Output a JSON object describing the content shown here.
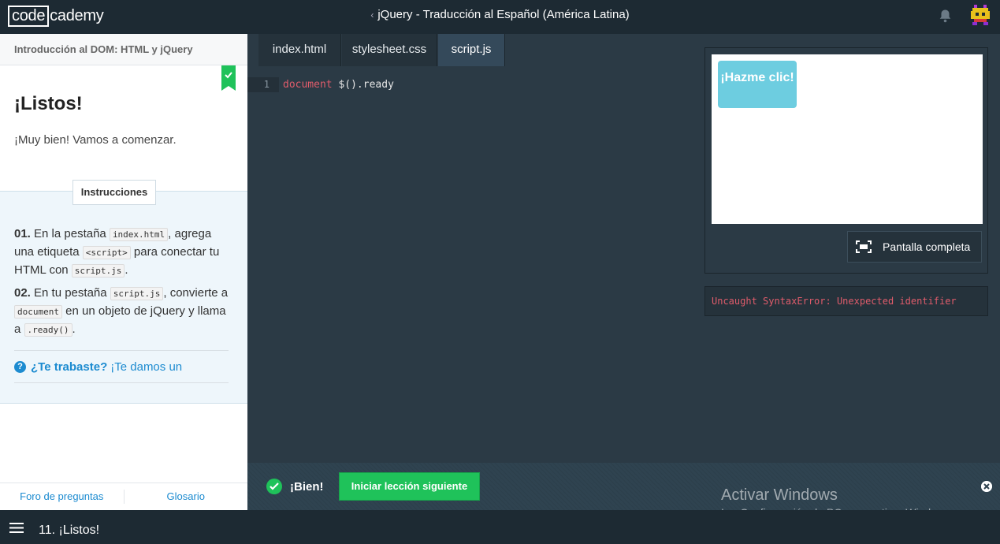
{
  "header": {
    "logo_box": "code",
    "logo_rest": "cademy",
    "course_title": "jQuery - Traducción al Español (América Latina)",
    "back_glyph": "‹"
  },
  "lesson": {
    "section": "Introducción al DOM: HTML y jQuery",
    "title": "¡Listos!",
    "description": "¡Muy bien! Vamos a comenzar.",
    "instructions_tab": "Instrucciones",
    "step1": {
      "num": "01.",
      "t1": " En la pestaña ",
      "c1": "index.html",
      "t2": ", agrega una etiqueta ",
      "c2": "<script>",
      "t3": " para conectar tu HTML con ",
      "c3": "script.js",
      "t4": "."
    },
    "step2": {
      "num": "02.",
      "t1": " En tu pestaña ",
      "c1": "script.js",
      "t2": ", convierte a ",
      "c2": "document",
      "t3": " en un objeto de jQuery y llama a ",
      "c3": ".ready()",
      "t4": "."
    },
    "hint_bold": "¿Te trabaste?",
    "hint_text": "¡Te damos un",
    "footer_links": [
      "Foro de preguntas",
      "Glosario"
    ]
  },
  "editor": {
    "tabs": [
      "index.html",
      "stylesheet.css",
      "script.js"
    ],
    "active_tab": "script.js",
    "line_number": "1",
    "code_kw": "document",
    "code_rest": " $().ready"
  },
  "preview": {
    "button_label": "¡Hazme clic!",
    "fullscreen_label": "Pantalla completa",
    "error": "Uncaught SyntaxError: Unexpected identifier"
  },
  "status": {
    "bien": "¡Bien!",
    "next_button": "Iniciar lección siguiente",
    "watermark_title": "Activar Windows",
    "watermark_sub": "Ir a Configuración de PC para activar Windows."
  },
  "footer": {
    "lesson_label": "11. ¡Listos!"
  },
  "colors": {
    "accent_green": "#1fc25a",
    "link_blue": "#1c8bd0",
    "error_red": "#e05c6b",
    "preview_button": "#6dcde0"
  }
}
